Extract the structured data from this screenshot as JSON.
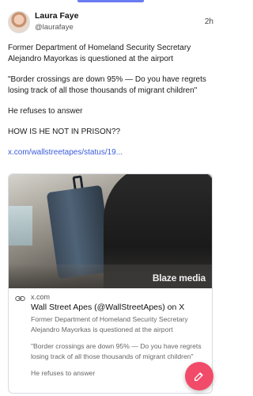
{
  "post": {
    "author_name": "Laura Faye",
    "author_handle": "@laurafaye",
    "time": "2h",
    "paragraphs": [
      "Former Department of Homeland Security Secretary Alejandro Mayorkas is questioned at the airport",
      "\"Border crossings are down 95% — Do you have regrets losing track of all those thousands of migrant children\"",
      "He refuses to answer",
      "HOW IS HE NOT IN PRISON??"
    ],
    "link_text": "x.com/wallstreetapes/status/19..."
  },
  "card": {
    "watermark": "Blaze media",
    "domain": "x.com",
    "title": "Wall Street Apes (@WallStreetApes) on X",
    "desc_paragraphs": [
      "Former Department of Homeland Security Secretary Alejandro Mayorkas is questioned at the airport",
      "\"Border crossings are down 95% — Do you have regrets losing track of all those thousands of migrant children\"",
      "He refuses to answer"
    ]
  },
  "icons": {
    "link": "link-icon",
    "compose": "compose-icon"
  },
  "colors": {
    "accent": "#6b7cf2",
    "link": "#3b5bdb",
    "fab": "#f24b6a"
  }
}
